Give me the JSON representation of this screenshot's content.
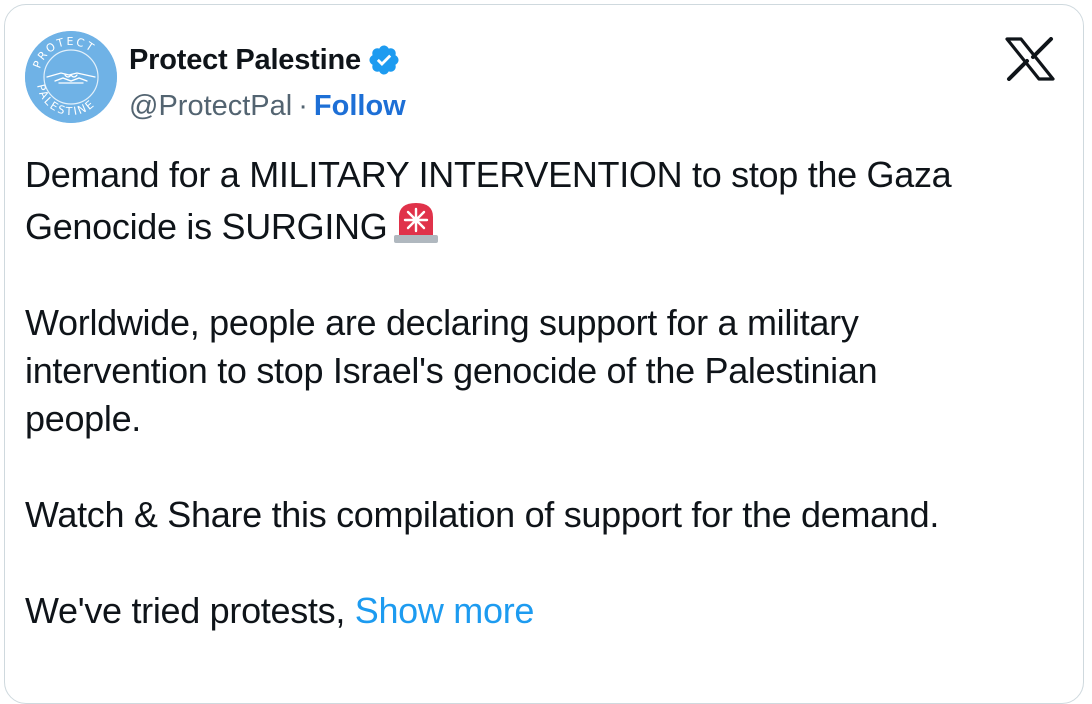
{
  "author": {
    "display_name": "Protect Palestine",
    "handle": "@ProtectPal",
    "separator": "·",
    "follow_label": "Follow",
    "verified": true,
    "avatar_text_top": "PROTECT",
    "avatar_text_bottom": "PALESTINE"
  },
  "platform": {
    "logo_icon": "x-logo-icon"
  },
  "tweet": {
    "line1": "Demand for a MILITARY INTERVENTION to stop the Gaza",
    "line2": "Genocide is SURGING",
    "siren_icon": "rotating-light-icon",
    "paragraph2_line1": "Worldwide, people are declaring support for a military",
    "paragraph2_line2": "intervention to stop Israel's genocide of the Palestinian",
    "paragraph2_line3": "people.",
    "paragraph3": "Watch & Share this compilation of support for the demand.",
    "paragraph4": "We've tried protests,",
    "show_more_label": "Show more"
  },
  "colors": {
    "link_blue": "#1d9bf0",
    "follow_blue": "#1d6fd6",
    "verified_blue": "#1d9bf0",
    "text": "#0f1419",
    "secondary_text": "#536471",
    "avatar_bg": "#6fb2e6"
  }
}
